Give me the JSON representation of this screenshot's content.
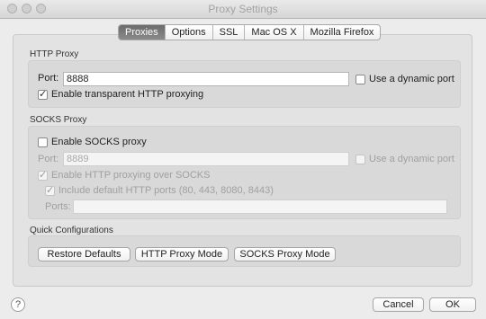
{
  "window": {
    "title": "Proxy Settings"
  },
  "tabs": [
    {
      "label": "Proxies",
      "selected": true
    },
    {
      "label": "Options",
      "selected": false
    },
    {
      "label": "SSL",
      "selected": false
    },
    {
      "label": "Mac OS X",
      "selected": false
    },
    {
      "label": "Mozilla Firefox",
      "selected": false
    }
  ],
  "http_proxy": {
    "group_label": "HTTP Proxy",
    "port_label": "Port:",
    "port_value": "8888",
    "dynamic_port_label": "Use a dynamic port",
    "dynamic_port_checked": false,
    "transparent_label": "Enable transparent HTTP proxying",
    "transparent_checked": true
  },
  "socks_proxy": {
    "group_label": "SOCKS Proxy",
    "enable_label": "Enable SOCKS proxy",
    "enable_checked": false,
    "port_label": "Port:",
    "port_value": "8889",
    "dynamic_port_label": "Use a dynamic port",
    "http_over_socks_label": "Enable HTTP proxying over SOCKS",
    "http_over_socks_checked": true,
    "default_ports_label": "Include default HTTP ports (80, 443, 8080, 8443)",
    "default_ports_checked": true,
    "ports_label": "Ports:",
    "ports_value": ""
  },
  "quick_config": {
    "group_label": "Quick Configurations",
    "restore_label": "Restore Defaults",
    "http_mode_label": "HTTP Proxy Mode",
    "socks_mode_label": "SOCKS Proxy Mode"
  },
  "footer": {
    "help_label": "?",
    "cancel_label": "Cancel",
    "ok_label": "OK"
  }
}
